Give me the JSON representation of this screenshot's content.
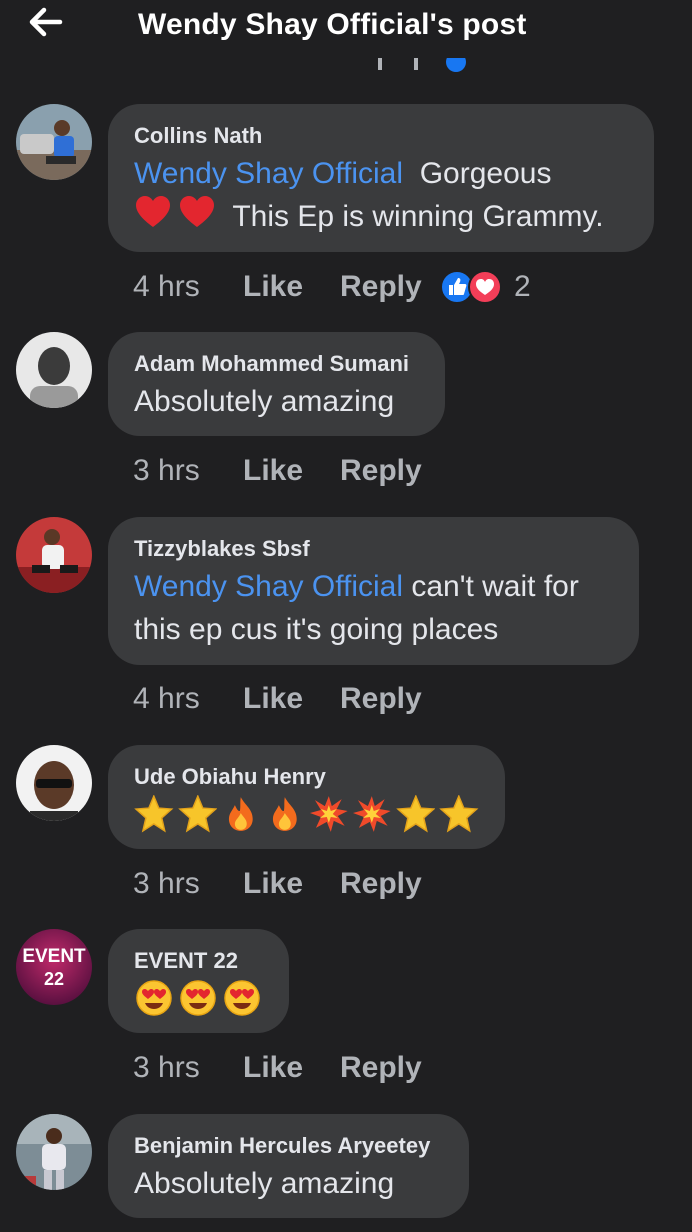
{
  "header": {
    "title": "Wendy Shay Official's post",
    "back_icon": "arrow-left-icon"
  },
  "colors": {
    "background": "#1f1f21",
    "bubble": "#3a3b3d",
    "mention": "#4b93f0",
    "secondary_text": "#b0b3b8"
  },
  "comments": [
    {
      "author": "Collins Nath",
      "mention": "Wendy Shay Official",
      "text_line1": "Gorgeous",
      "text_line2": "This Ep is winning Grammy.",
      "emojis": [
        "red-heart-icon",
        "red-heart-icon"
      ],
      "time": "4 hrs",
      "like_label": "Like",
      "reply_label": "Reply",
      "reaction_icons": [
        "like-reaction-icon",
        "love-reaction-icon"
      ],
      "reaction_count": "2"
    },
    {
      "author": "Adam Mohammed Sumani",
      "text": "Absolutely amazing",
      "time": "3 hrs",
      "like_label": "Like",
      "reply_label": "Reply"
    },
    {
      "author": "Tizzyblakes Sbsf",
      "mention": "Wendy Shay Official",
      "text_line1": "can't wait for",
      "text_line2": "this ep cus it's going places",
      "time": "4 hrs",
      "like_label": "Like",
      "reply_label": "Reply"
    },
    {
      "author": "Ude Obiahu Henry",
      "emojis": [
        "star-icon",
        "star-icon",
        "fire-icon",
        "fire-icon",
        "collision-icon",
        "collision-icon",
        "star-icon",
        "star-icon"
      ],
      "time": "3 hrs",
      "like_label": "Like",
      "reply_label": "Reply"
    },
    {
      "author": "EVENT 22",
      "avatar_text_top": "EVENT",
      "avatar_text_bottom": "22",
      "emojis": [
        "heart-eyes-icon",
        "heart-eyes-icon",
        "heart-eyes-icon"
      ],
      "time": "3 hrs",
      "like_label": "Like",
      "reply_label": "Reply"
    },
    {
      "author": "Benjamin Hercules Aryeetey",
      "text": "Absolutely amazing"
    }
  ]
}
